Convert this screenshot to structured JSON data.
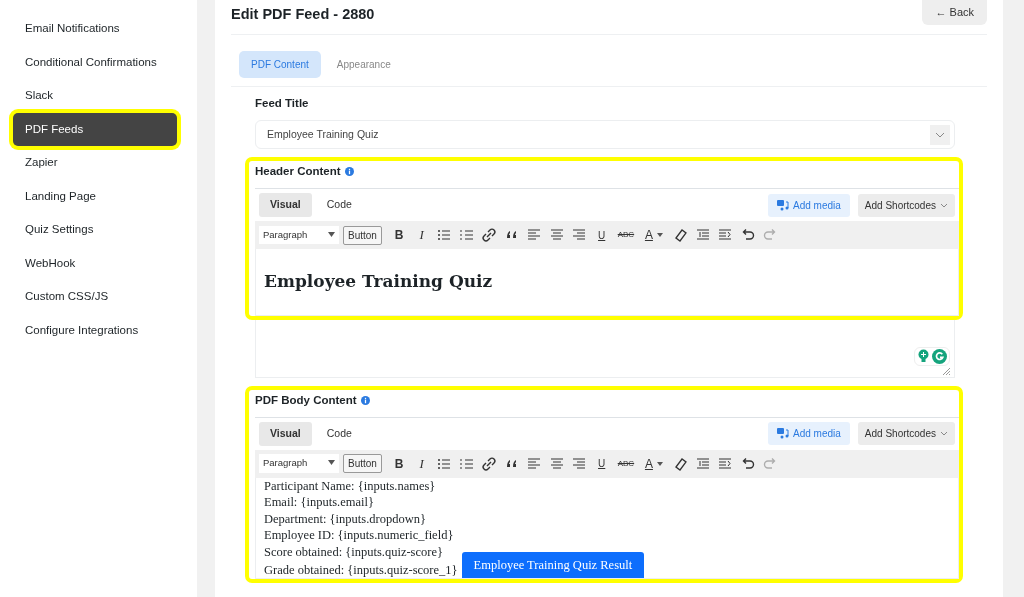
{
  "sidebar": {
    "items": [
      {
        "label": "Email Notifications",
        "selected": false,
        "highlighted": false
      },
      {
        "label": "Conditional Confirmations",
        "selected": false,
        "highlighted": false
      },
      {
        "label": "Slack",
        "selected": false,
        "highlighted": false
      },
      {
        "label": "PDF Feeds",
        "selected": true,
        "highlighted": true
      },
      {
        "label": "Zapier",
        "selected": false,
        "highlighted": false
      },
      {
        "label": "Landing Page",
        "selected": false,
        "highlighted": false
      },
      {
        "label": "Quiz Settings",
        "selected": false,
        "highlighted": false
      },
      {
        "label": "WebHook",
        "selected": false,
        "highlighted": false
      },
      {
        "label": "Custom CSS/JS",
        "selected": false,
        "highlighted": false
      },
      {
        "label": "Configure Integrations",
        "selected": false,
        "highlighted": false
      }
    ]
  },
  "page": {
    "title": "Edit PDF Feed - 2880",
    "back_button": "← Back"
  },
  "tabs": [
    {
      "label": "PDF Content",
      "selected": true
    },
    {
      "label": "Appearance",
      "selected": false
    }
  ],
  "feed_title": {
    "label": "Feed Title",
    "value": "Employee Training Quiz"
  },
  "editors": [
    {
      "label": "Header Content",
      "highlighted": true,
      "mode_tabs": [
        {
          "label": "Visual",
          "selected": true
        },
        {
          "label": "Code",
          "selected": false
        }
      ],
      "add_media": "Add media",
      "add_shortcodes": "Add Shortcodes",
      "toolbar": [
        {
          "kind": "select",
          "label": "Paragraph",
          "disabled": false
        },
        {
          "kind": "button",
          "label": "Button",
          "disabled": false
        },
        {
          "kind": "bold",
          "label": "B",
          "disabled": false
        },
        {
          "kind": "italic",
          "label": "I",
          "disabled": false
        },
        {
          "kind": "bullets",
          "disabled": false
        },
        {
          "kind": "numbers",
          "disabled": false
        },
        {
          "kind": "link",
          "disabled": false
        },
        {
          "kind": "quote",
          "disabled": false
        },
        {
          "kind": "alignleft",
          "disabled": false
        },
        {
          "kind": "aligncenter",
          "disabled": false
        },
        {
          "kind": "alignright",
          "disabled": false
        },
        {
          "kind": "underline",
          "label": "U",
          "disabled": false
        },
        {
          "kind": "strike",
          "label": "ABC",
          "disabled": false
        },
        {
          "kind": "color",
          "label": "A",
          "disabled": false
        },
        {
          "kind": "eraser",
          "disabled": false
        },
        {
          "kind": "outdent",
          "disabled": false
        },
        {
          "kind": "indent",
          "disabled": false
        },
        {
          "kind": "undo",
          "disabled": false
        },
        {
          "kind": "redo",
          "disabled": true
        }
      ],
      "content": [
        {
          "kind": "heading",
          "text": "Employee Training Quiz"
        }
      ]
    },
    {
      "label": "PDF Body Content",
      "highlighted": true,
      "mode_tabs": [
        {
          "label": "Visual",
          "selected": true
        },
        {
          "label": "Code",
          "selected": false
        }
      ],
      "add_media": "Add media",
      "add_shortcodes": "Add Shortcodes",
      "toolbar": [
        {
          "kind": "select",
          "label": "Paragraph",
          "disabled": false
        },
        {
          "kind": "button",
          "label": "Button",
          "disabled": false
        },
        {
          "kind": "bold",
          "label": "B",
          "disabled": false
        },
        {
          "kind": "italic",
          "label": "I",
          "disabled": false
        },
        {
          "kind": "bullets",
          "disabled": false
        },
        {
          "kind": "numbers",
          "disabled": false
        },
        {
          "kind": "link",
          "disabled": false
        },
        {
          "kind": "quote",
          "disabled": false
        },
        {
          "kind": "alignleft",
          "disabled": false
        },
        {
          "kind": "aligncenter",
          "disabled": false
        },
        {
          "kind": "alignright",
          "disabled": false
        },
        {
          "kind": "underline",
          "label": "U",
          "disabled": false
        },
        {
          "kind": "strike",
          "label": "ABC",
          "disabled": false
        },
        {
          "kind": "color",
          "label": "A",
          "disabled": false
        },
        {
          "kind": "eraser",
          "disabled": false
        },
        {
          "kind": "outdent",
          "disabled": false
        },
        {
          "kind": "indent",
          "disabled": false
        },
        {
          "kind": "undo",
          "disabled": false
        },
        {
          "kind": "redo",
          "disabled": true
        }
      ],
      "content": [
        {
          "kind": "line",
          "text": "Participant Name: {inputs.names}"
        },
        {
          "kind": "line",
          "text": "Email: {inputs.email}"
        },
        {
          "kind": "line",
          "text": "Department: {inputs.dropdown}"
        },
        {
          "kind": "line",
          "text": "Employee ID: {inputs.numeric_field}"
        },
        {
          "kind": "line",
          "text": "Score obtained: {inputs.quiz-score}"
        },
        {
          "kind": "line",
          "text": "Grade obtained: {inputs.quiz-score_1}"
        },
        {
          "kind": "button",
          "text": "Employee Training Quiz Result"
        }
      ]
    }
  ]
}
